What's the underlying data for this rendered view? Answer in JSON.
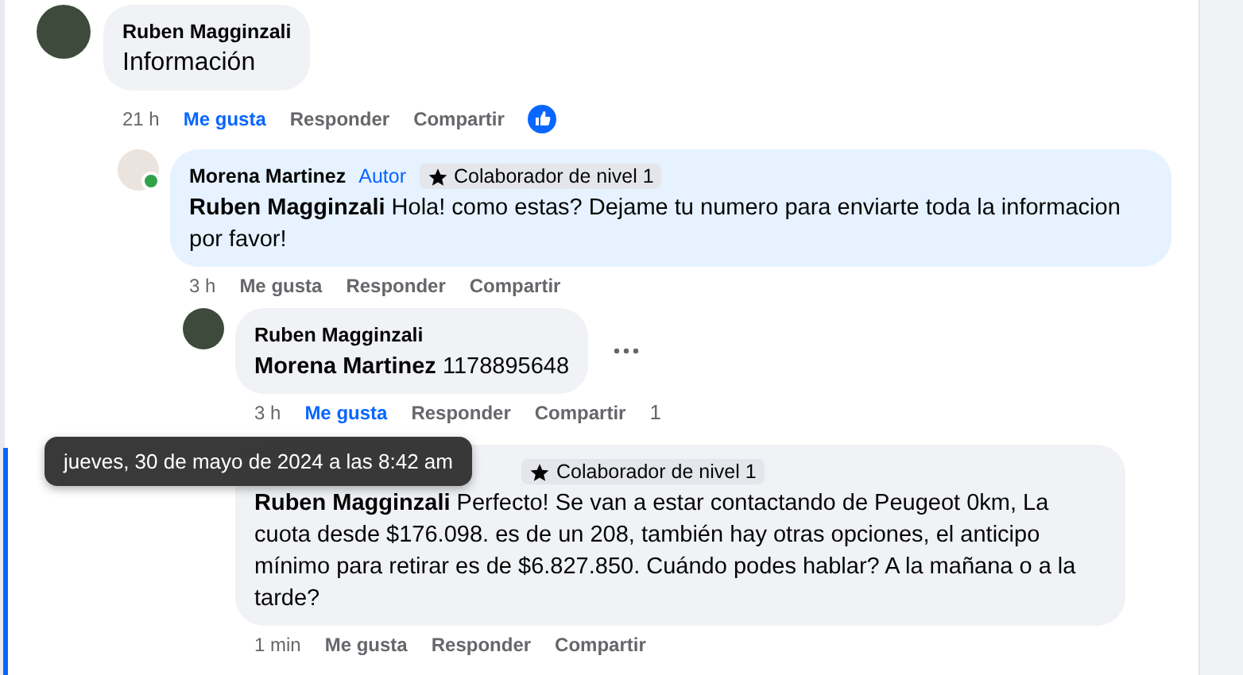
{
  "comment": {
    "author": "Ruben Magginzali",
    "color": "#3e4b3c",
    "text": "Información",
    "time": "21 h",
    "liked": true,
    "like_reaction": true,
    "actions": [
      "Me gusta",
      "Responder",
      "Compartir"
    ],
    "replies": [
      {
        "author": "Morena Martinez",
        "role": "Autor",
        "badge": "Colaborador de nivel 1",
        "color": "#ebe3dd",
        "online": true,
        "highlight": true,
        "mention": "Ruben Magginzali",
        "text": "Hola! como estas? Dejame tu numero para enviarte toda la informacion por favor!",
        "time": "3 h",
        "liked": false,
        "actions": [
          "Me gusta",
          "Responder",
          "Compartir"
        ],
        "replies": [
          {
            "author": "Ruben Magginzali",
            "color": "#3e4b3c",
            "online": false,
            "mention": "Morena Martinez",
            "text": "1178895648",
            "time": "3 h",
            "liked": true,
            "more": true,
            "count": "1",
            "actions": [
              "Me gusta",
              "Responder",
              "Compartir"
            ]
          },
          {
            "badge": "Colaborador de nivel 1",
            "focused": true,
            "mention": "Ruben Magginzali",
            "text": "Perfecto! Se van a estar contactando de Peugeot 0km, La cuota desde $176.098. es de un 208, también hay otras opciones, el anticipo mínimo para retirar es de $6.827.850. Cuándo podes hablar? A la mañana o a la tarde?",
            "time": "1 min",
            "liked": false,
            "actions": [
              "Me gusta",
              "Responder",
              "Compartir"
            ]
          }
        ]
      }
    ]
  },
  "tooltip": {
    "text": "jueves, 30 de mayo de 2024 a las 8:42 am"
  }
}
